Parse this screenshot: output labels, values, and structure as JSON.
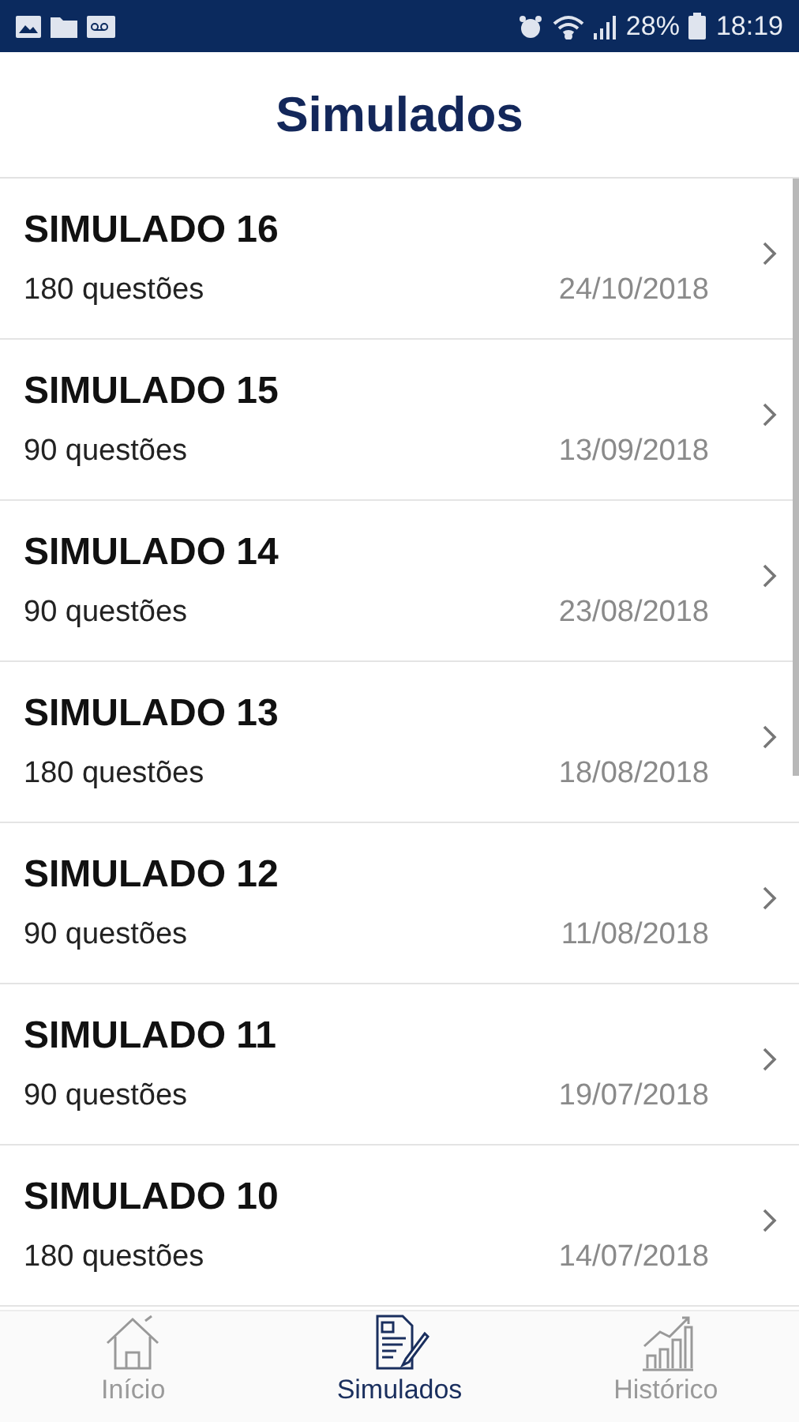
{
  "status_bar": {
    "battery": "28%",
    "time": "18:19"
  },
  "header": {
    "title": "Simulados"
  },
  "exams": [
    {
      "title": "SIMULADO 16",
      "questions": "180 questões",
      "date": "24/10/2018"
    },
    {
      "title": "SIMULADO 15",
      "questions": "90 questões",
      "date": "13/09/2018"
    },
    {
      "title": "SIMULADO 14",
      "questions": "90 questões",
      "date": "23/08/2018"
    },
    {
      "title": "SIMULADO 13",
      "questions": "180 questões",
      "date": "18/08/2018"
    },
    {
      "title": "SIMULADO 12",
      "questions": "90 questões",
      "date": "11/08/2018"
    },
    {
      "title": "SIMULADO 11",
      "questions": "90 questões",
      "date": "19/07/2018"
    },
    {
      "title": "SIMULADO 10",
      "questions": "180 questões",
      "date": "14/07/2018"
    }
  ],
  "tabs": [
    {
      "kind": "home",
      "label": "Início",
      "selected": false
    },
    {
      "kind": "exams",
      "label": "Simulados",
      "selected": true
    },
    {
      "kind": "history",
      "label": "Histórico",
      "selected": false
    }
  ]
}
